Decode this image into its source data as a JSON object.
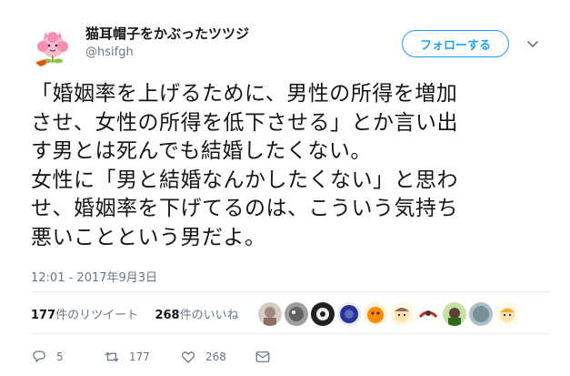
{
  "user": {
    "display_name": "猫耳帽子をかぶったツツジ",
    "handle": "@hsifgh"
  },
  "follow_button": {
    "label": "フォローする"
  },
  "tweet": {
    "lines": [
      "「婚姻率を上げるために、男性の所得を増加",
      "させ、女性の所得を低下させる」とか言い出",
      "す男とは死んでも結婚したくない。",
      "女性に「男と結婚なんかしたくない」と思わ",
      "せ、婚姻率を下げてるのは、こういう気持ち",
      "悪いことという男だよ。"
    ],
    "timestamp": "12:01 - 2017年9月3日"
  },
  "stats": {
    "retweets_count": "177",
    "retweets_label": "件のリツイート",
    "likes_count": "268",
    "likes_label": "件のいいね"
  },
  "actions": {
    "reply_count": "5",
    "retweet_count": "177",
    "like_count": "268"
  },
  "colors": {
    "accent": "#1da1f2",
    "secondary_text": "#657786",
    "divider": "#e6ecf0"
  },
  "icons": [
    "caret-down-icon",
    "reply-icon",
    "retweet-icon",
    "like-icon",
    "dm-icon"
  ]
}
